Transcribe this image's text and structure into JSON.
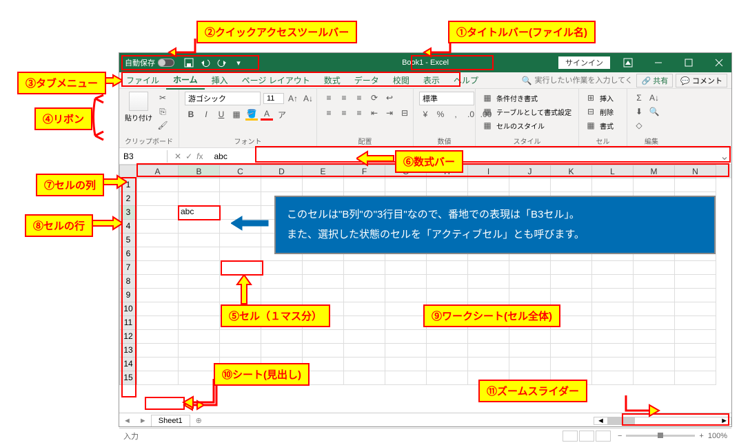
{
  "annotations": {
    "a1": "①タイトルバー(ファイル名)",
    "a2": "②クイックアクセスツールバー",
    "a3": "③タブメニュー",
    "a4": "④リボン",
    "a5": "⑤セル（１マス分）",
    "a6": "⑥数式バー",
    "a7": "⑦セルの列",
    "a8": "⑧セルの行",
    "a9": "⑨ワークシート(セル全体)",
    "a10": "⑩シート(見出し)",
    "a11": "⑪ズームスライダー"
  },
  "title": "Book1 - Excel",
  "autosave_label": "自動保存",
  "signin": "サインイン",
  "tabs": [
    "ファイル",
    "ホーム",
    "挿入",
    "ページ レイアウト",
    "数式",
    "データ",
    "校閲",
    "表示",
    "ヘルプ"
  ],
  "active_tab_index": 1,
  "tellme_placeholder": "実行したい作業を入力してください",
  "share": "共有",
  "comment": "コメント",
  "ribbon_groups": {
    "clipboard": "クリップボード",
    "paste": "貼り付け",
    "font": "フォント",
    "font_name": "游ゴシック",
    "font_size": "11",
    "align": "配置",
    "number": "数値",
    "number_format": "標準",
    "styles": "スタイル",
    "style_cond": "条件付き書式",
    "style_table": "テーブルとして書式設定",
    "style_cell": "セルのスタイル",
    "cells": "セル",
    "cells_insert": "挿入",
    "cells_delete": "削除",
    "cells_format": "書式",
    "editing": "編集"
  },
  "namebox": "B3",
  "formula_value": "abc",
  "columns": [
    "A",
    "B",
    "C",
    "D",
    "E",
    "F",
    "G",
    "H",
    "I",
    "J",
    "K",
    "L",
    "M",
    "N"
  ],
  "rows": [
    "1",
    "2",
    "3",
    "4",
    "5",
    "6",
    "7",
    "8",
    "9",
    "10",
    "11",
    "12",
    "13",
    "14",
    "15"
  ],
  "active_cell_value": "abc",
  "explain_line1": "このセルは\"B列\"の\"3行目\"なので、番地での表現は「B3セル」。",
  "explain_line2": "また、選択した状態のセルを「アクティブセル」とも呼びます。",
  "sheet_name": "Sheet1",
  "status_mode": "入力",
  "zoom_pct": "100%"
}
